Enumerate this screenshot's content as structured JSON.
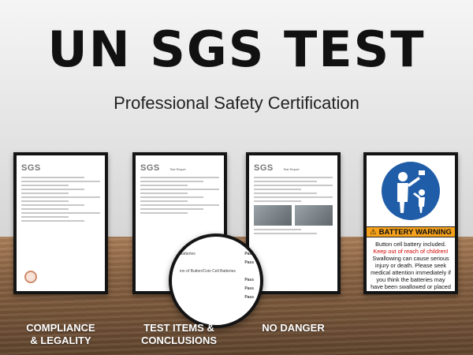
{
  "headline": "UN SGS TEST",
  "subheadline": "Professional Safety Certification",
  "cards": [
    {
      "brand": "SGS",
      "report_title": ""
    },
    {
      "brand": "SGS",
      "report_title": "Test Report"
    },
    {
      "brand": "SGS",
      "report_title": "Test Report"
    }
  ],
  "warning_card": {
    "title": "BATTERY WARNING",
    "line1": "Button cell battery included.",
    "line2_red": "Keep out of reach of children!",
    "body": "Swallowing can cause serious injury or death. Please seek medical attention immediately if you think the batteries may have been swallowed or placed inside any part of the body!",
    "colors": {
      "bar": "#f5a11c",
      "icon_bg": "#1f5da8",
      "alert_text": "#d40000"
    }
  },
  "magnifier_rows": [
    {
      "label": "Batteries",
      "value": "Pass"
    },
    {
      "label": "",
      "value": "Pass"
    },
    {
      "label": "ion of Button/Coin Cell Batteries",
      "value": ""
    },
    {
      "label": "",
      "value": "Pass"
    },
    {
      "label": "",
      "value": "Pass"
    },
    {
      "label": "",
      "value": "Pass"
    }
  ],
  "labels": [
    {
      "line1": "COMPLIANCE",
      "line2": "& LEGALITY"
    },
    {
      "line1": "TEST ITEMS &",
      "line2": "CONCLUSIONS"
    },
    {
      "line1": "NO DANGER",
      "line2": ""
    }
  ]
}
